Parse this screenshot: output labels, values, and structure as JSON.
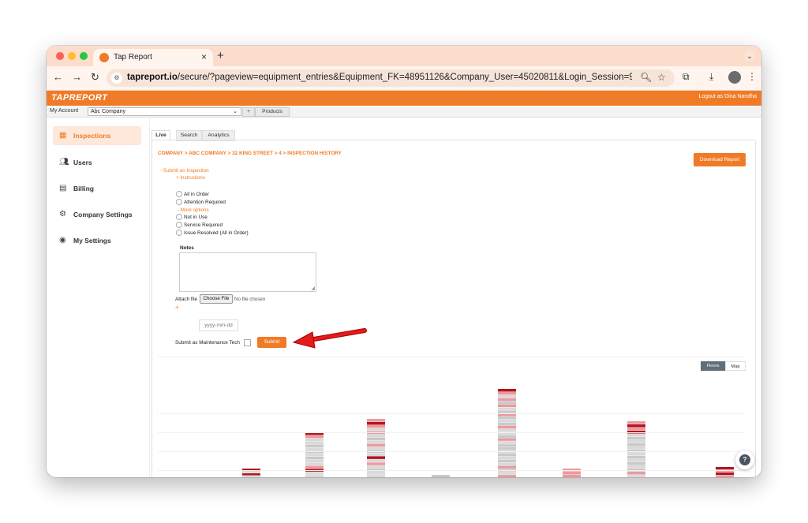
{
  "browser": {
    "tab_title": "Tap Report",
    "new_tab": "+",
    "close": "×",
    "url_host": "tapreport.io",
    "url_path": "/secure/?pageview=equipment_entries&Equipment_FK=48951126&Company_User=45020811&Login_Session=95opit7n79l0atlhz476fvfktse..."
  },
  "app": {
    "logo": "TAPREPORT",
    "logout": "Logout as Dina Nandha",
    "account_label": "My Account",
    "company_selected": "Abc Company",
    "plus_btn": "+",
    "products_btn": "Products",
    "accent_color": "#f07b27"
  },
  "sidebar": {
    "items": [
      {
        "label": "Inspections",
        "icon": "inspections-icon",
        "active": true
      },
      {
        "label": "Users",
        "icon": "users-icon"
      },
      {
        "label": "Billing",
        "icon": "billing-icon"
      },
      {
        "label": "Company Settings",
        "icon": "gear-icon"
      },
      {
        "label": "My Settings",
        "icon": "user-circle-icon"
      }
    ]
  },
  "main": {
    "tabs": [
      "Live",
      "Search",
      "Analytics"
    ],
    "breadcrumb": "COMPANY > ABC COMPANY > 32 KING STREET > 4 > INSPECTION HISTORY",
    "download_btn": "Download Report",
    "submit_toggle": "- Submit an Inspection",
    "instructions": "+ Instructions",
    "options": [
      "All in Order",
      "Attention Required"
    ],
    "more_options": "- More options",
    "more": [
      "Not in Use",
      "Service Required",
      "Issue Resolved (All in Order)"
    ],
    "notes_label": "Notes",
    "attach_label": "Attach file",
    "choose_file": "Choose File",
    "no_file": "No file chosen",
    "add": "+",
    "date_placeholder": "yyyy-mm-dd",
    "maint_label": "Submit as Maintenance Tech",
    "submit_btn": "Submit",
    "view_floors": "Floors",
    "view_map": "Map",
    "help": "?"
  }
}
